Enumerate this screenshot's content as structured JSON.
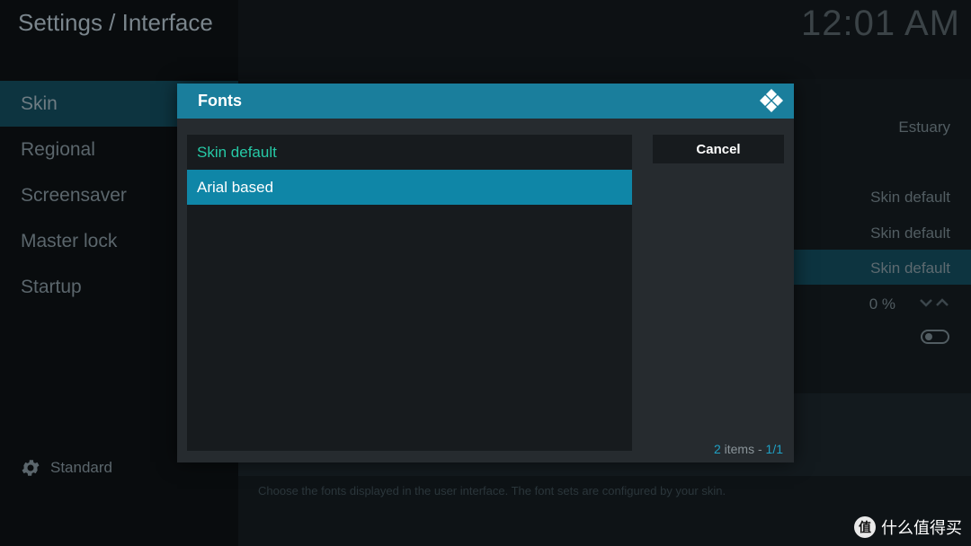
{
  "header": {
    "title": "Settings / Interface",
    "clock": "12:01 AM"
  },
  "sidebar": {
    "items": [
      {
        "label": "Skin",
        "active": true
      },
      {
        "label": "Regional",
        "active": false
      },
      {
        "label": "Screensaver",
        "active": false
      },
      {
        "label": "Master lock",
        "active": false
      },
      {
        "label": "Startup",
        "active": false
      }
    ],
    "level": {
      "icon": "gear-icon",
      "label": "Standard"
    }
  },
  "settings_values": {
    "skin": "Estuary",
    "value_1": "Skin default",
    "value_2": "Skin default",
    "value_3": "Skin default",
    "zoom": "0 %"
  },
  "description": "Choose the fonts displayed in the user interface. The font sets are configured by your skin.",
  "dialog": {
    "title": "Fonts",
    "logo_icon": "kodi-logo-icon",
    "options": [
      {
        "label": "Skin default",
        "state": "selected"
      },
      {
        "label": "Arial based",
        "state": "focused"
      }
    ],
    "cancel_label": "Cancel",
    "count": {
      "number": "2",
      "text": " items - ",
      "page": "1/1"
    }
  },
  "watermark": {
    "badge": "值",
    "text": "什么值得买"
  },
  "colors": {
    "accent": "#1a7e9c",
    "focus": "#0f86a7",
    "selected_text": "#26c9a6",
    "dialog_bg": "#262b2f"
  }
}
